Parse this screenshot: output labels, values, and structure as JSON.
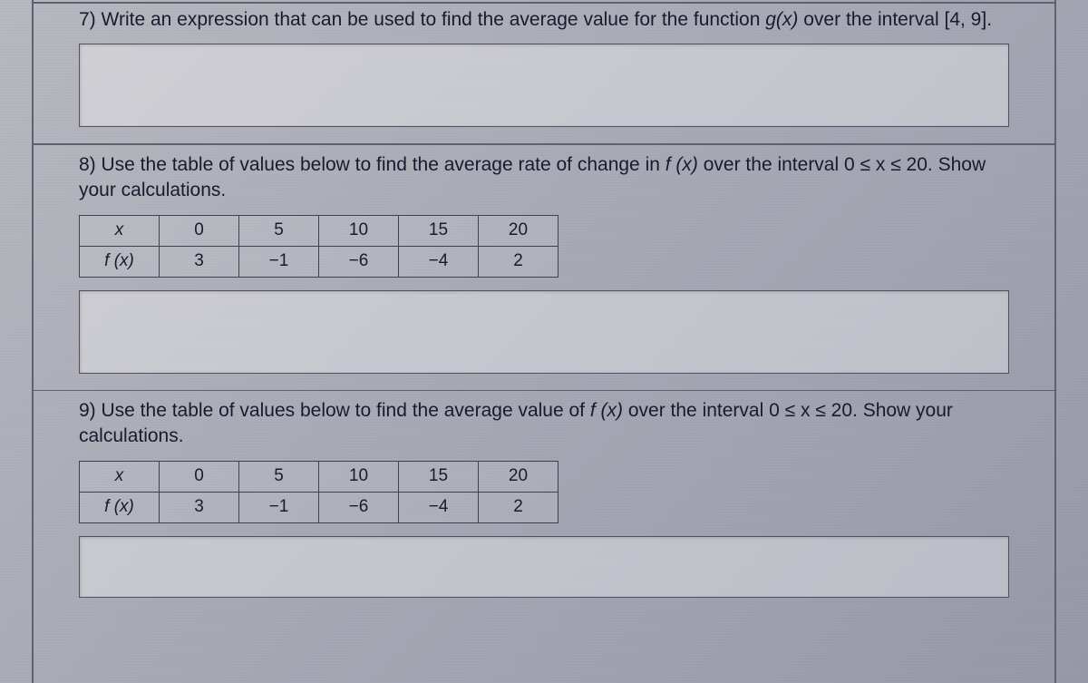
{
  "questions": {
    "q7": {
      "text_part1": "7) Write an expression that can be used to find the average value for the function ",
      "function": "g(x)",
      "text_part2": " over the interval [4, 9]."
    },
    "q8": {
      "text_part1": "8) Use the table of values below to find the average rate of change in ",
      "function": "f (x)",
      "text_part2": " over the interval 0 ≤ x ≤ 20. Show your calculations.",
      "table": {
        "row1_label": "x",
        "row1_values": [
          "0",
          "5",
          "10",
          "15",
          "20"
        ],
        "row2_label": "f (x)",
        "row2_values": [
          "3",
          "−1",
          "−6",
          "−4",
          "2"
        ]
      }
    },
    "q9": {
      "text_part1": "9) Use the table of values below to find the average value of ",
      "function": "f (x)",
      "text_part2": " over the interval 0 ≤ x ≤ 20. Show your calculations.",
      "table": {
        "row1_label": "x",
        "row1_values": [
          "0",
          "5",
          "10",
          "15",
          "20"
        ],
        "row2_label": "f (x)",
        "row2_values": [
          "3",
          "−1",
          "−6",
          "−4",
          "2"
        ]
      }
    }
  }
}
